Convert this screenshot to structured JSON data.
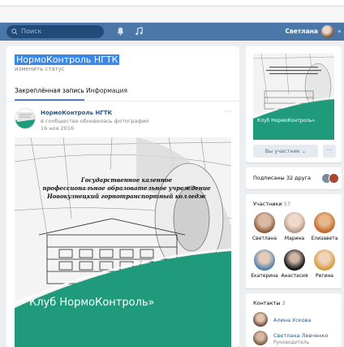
{
  "header": {
    "search_placeholder": "Поиск",
    "user_name": "Светлана",
    "bell_icon": "bell-icon",
    "music_icon": "music-icon",
    "brand_color": "#4a76a8"
  },
  "page": {
    "title": "НормоКонтроль НГТК",
    "status": "изменить статус",
    "tabs": [
      {
        "label": "Закреплённая запись",
        "active": true
      },
      {
        "label": "Информация",
        "active": false
      }
    ]
  },
  "post": {
    "author": "НормоКонтроль НГТК",
    "action": "в сообществе обновилась фотография",
    "date": "16 ноя 2016",
    "more": "···",
    "image": {
      "caption_line1": "Государственное казенное",
      "caption_line2": "профессиональное образовательное учреждение",
      "caption_line3": "Новокузнецкий горнотранспортный колледж",
      "club": "Клуб НормоКонтроль»"
    }
  },
  "sidebar": {
    "cover_club": "Клуб НормоКонтроль»",
    "member_button": "Вы участник",
    "more_button": "···",
    "friends": "Подписаны 32 друга",
    "members": {
      "title": "Участники",
      "count": "57",
      "people": [
        {
          "name": "Светлана"
        },
        {
          "name": "Марина"
        },
        {
          "name": "Елизавета"
        },
        {
          "name": "Екатерина"
        },
        {
          "name": "Анастасия"
        },
        {
          "name": "Регина"
        }
      ]
    },
    "contacts": {
      "title": "Контакты",
      "count": "3",
      "people": [
        {
          "name": "Алина Ускова",
          "role": ""
        },
        {
          "name": "Светлана Левченко",
          "role": "Руководитель"
        }
      ]
    }
  }
}
